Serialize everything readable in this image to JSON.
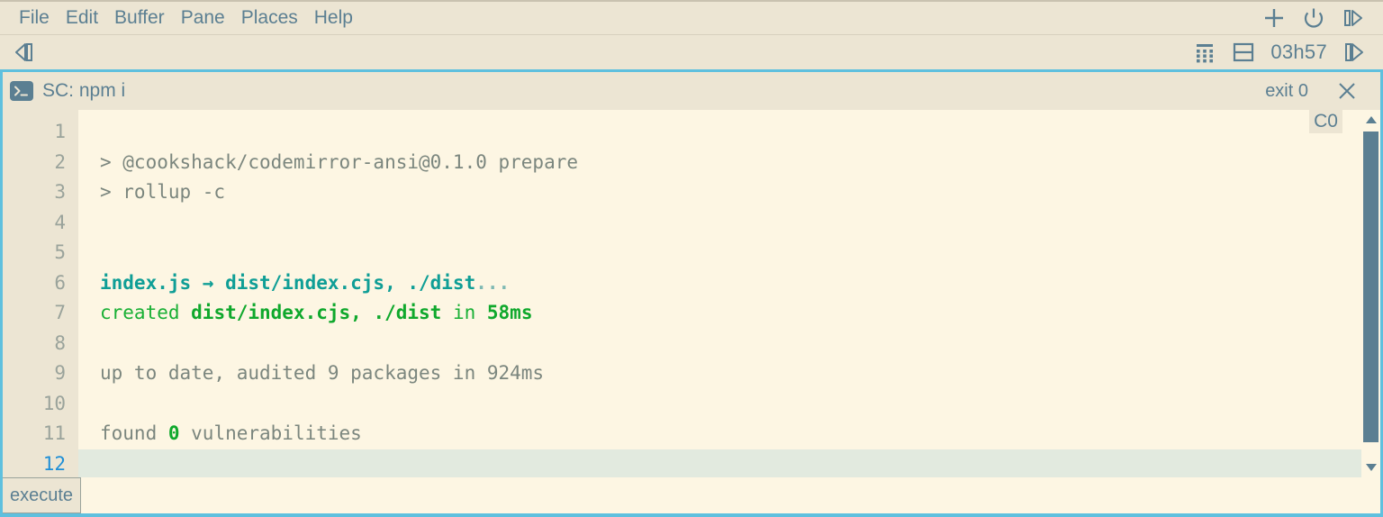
{
  "menubar": {
    "items": [
      {
        "label": "File"
      },
      {
        "label": "Edit"
      },
      {
        "label": "Buffer"
      },
      {
        "label": "Pane"
      },
      {
        "label": "Places"
      },
      {
        "label": "Help"
      }
    ],
    "right_icons": [
      {
        "name": "plus-icon",
        "glyph": "+"
      },
      {
        "name": "power-icon",
        "glyph": "power"
      },
      {
        "name": "next-pane-icon",
        "glyph": "play-bar"
      }
    ]
  },
  "toolbar": {
    "back_icon": "prev-pane-icon",
    "grid_icon": "keypad-grid-icon",
    "split_icon": "split-pane-icon",
    "clock": "03h57",
    "forward_icon": "next-pane-icon"
  },
  "pane": {
    "icon": "terminal-icon",
    "title": "SC: npm i",
    "exit_status": "exit 0",
    "close_label": "close-icon",
    "column_badge": "C0",
    "accent_color": "#5fc0de"
  },
  "editor": {
    "line_numbers": [
      "1",
      "2",
      "3",
      "4",
      "5",
      "6",
      "7",
      "8",
      "9",
      "10",
      "11",
      "12"
    ],
    "active_line": "12",
    "lines": [
      {
        "num": "1",
        "segments": []
      },
      {
        "num": "2",
        "segments": [
          {
            "text": "> @cookshack/codemirror-ansi@0.1.0 prepare",
            "style": "gray"
          }
        ]
      },
      {
        "num": "3",
        "segments": [
          {
            "text": "> rollup -c",
            "style": "gray"
          }
        ]
      },
      {
        "num": "4",
        "segments": []
      },
      {
        "num": "5",
        "segments": []
      },
      {
        "num": "6",
        "segments": [
          {
            "text": "index.js → dist/index.cjs, ./dist",
            "style": "cyan-bold"
          },
          {
            "text": "...",
            "style": "cyan-dim"
          }
        ]
      },
      {
        "num": "7",
        "segments": [
          {
            "text": "created ",
            "style": "green"
          },
          {
            "text": "dist/index.cjs, ./dist",
            "style": "green-bold"
          },
          {
            "text": " in ",
            "style": "green"
          },
          {
            "text": "58ms",
            "style": "green-bold"
          }
        ]
      },
      {
        "num": "8",
        "segments": []
      },
      {
        "num": "9",
        "segments": [
          {
            "text": "up to date, audited 9 packages in 924ms",
            "style": "gray"
          }
        ]
      },
      {
        "num": "10",
        "segments": []
      },
      {
        "num": "11",
        "segments": [
          {
            "text": "found ",
            "style": "gray"
          },
          {
            "text": "0",
            "style": "green-bold"
          },
          {
            "text": " vulnerabilities",
            "style": "gray"
          }
        ]
      },
      {
        "num": "12",
        "segments": []
      }
    ]
  },
  "statusbar": {
    "execute_label": "execute"
  },
  "colors": {
    "background": "#ece5d3",
    "editor_background": "#fdf6e3",
    "gutter": "#ece5d3",
    "text": "#5b7f92",
    "code_text": "#7b867e",
    "cyan": "#0f9e96",
    "green": "#19b035",
    "active_line": "#e2eadf",
    "active_line_number": "#1f8fd6",
    "pane_border": "#5fc0de",
    "scrollbar_thumb": "#5b7f92"
  }
}
